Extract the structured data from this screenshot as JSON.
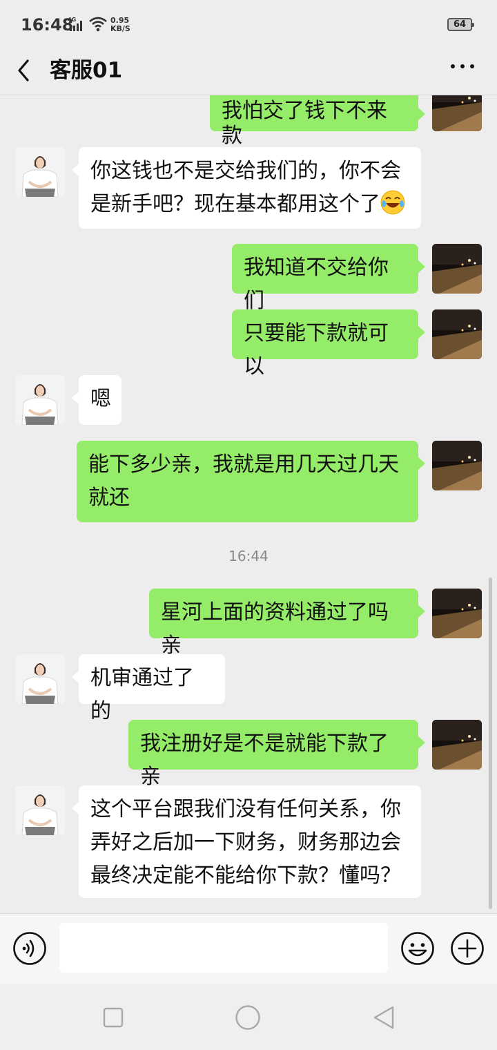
{
  "status_bar": {
    "time": "16:48",
    "network": "4G",
    "speed_value": "0.95",
    "speed_unit": "KB/S",
    "battery": "64"
  },
  "header": {
    "title": "客服01",
    "back_icon": "chevron-left-icon",
    "more_icon": "more-dots-icon"
  },
  "messages": [
    {
      "side": "out",
      "text": "我怕交了钱下不来款"
    },
    {
      "side": "in",
      "text": "你这钱也不是交给我们的，你不会是新手吧？现在基本都用这个了",
      "emoji": "rolling-laughing-emoji"
    },
    {
      "side": "out",
      "text": "我知道不交给你们"
    },
    {
      "side": "out",
      "text": "只要能下款就可以"
    },
    {
      "side": "in",
      "text": "嗯"
    },
    {
      "side": "out",
      "text": "能下多少亲，我就是用几天过几天就还"
    },
    {
      "side": "out",
      "text": "星河上面的资料通过了吗亲"
    },
    {
      "side": "in",
      "text": "机审通过了的"
    },
    {
      "side": "out",
      "text": "我注册好是不是就能下款了亲"
    },
    {
      "side": "in",
      "text": "这个平台跟我们没有任何关系，你弄好之后加一下财务，财务那边会最终决定能不能给你下款？懂吗？"
    }
  ],
  "timestamp": "16:44",
  "input_bar": {
    "voice_icon": "voice-icon",
    "emoji_icon": "emoji-face-icon",
    "plus_icon": "plus-icon",
    "value": ""
  },
  "system_nav": {
    "recent_icon": "square-icon",
    "home_icon": "circle-icon",
    "back_icon": "triangle-back-icon"
  },
  "colors": {
    "out_bubble": "#95ec69",
    "in_bubble": "#ffffff",
    "background": "#ededed"
  }
}
